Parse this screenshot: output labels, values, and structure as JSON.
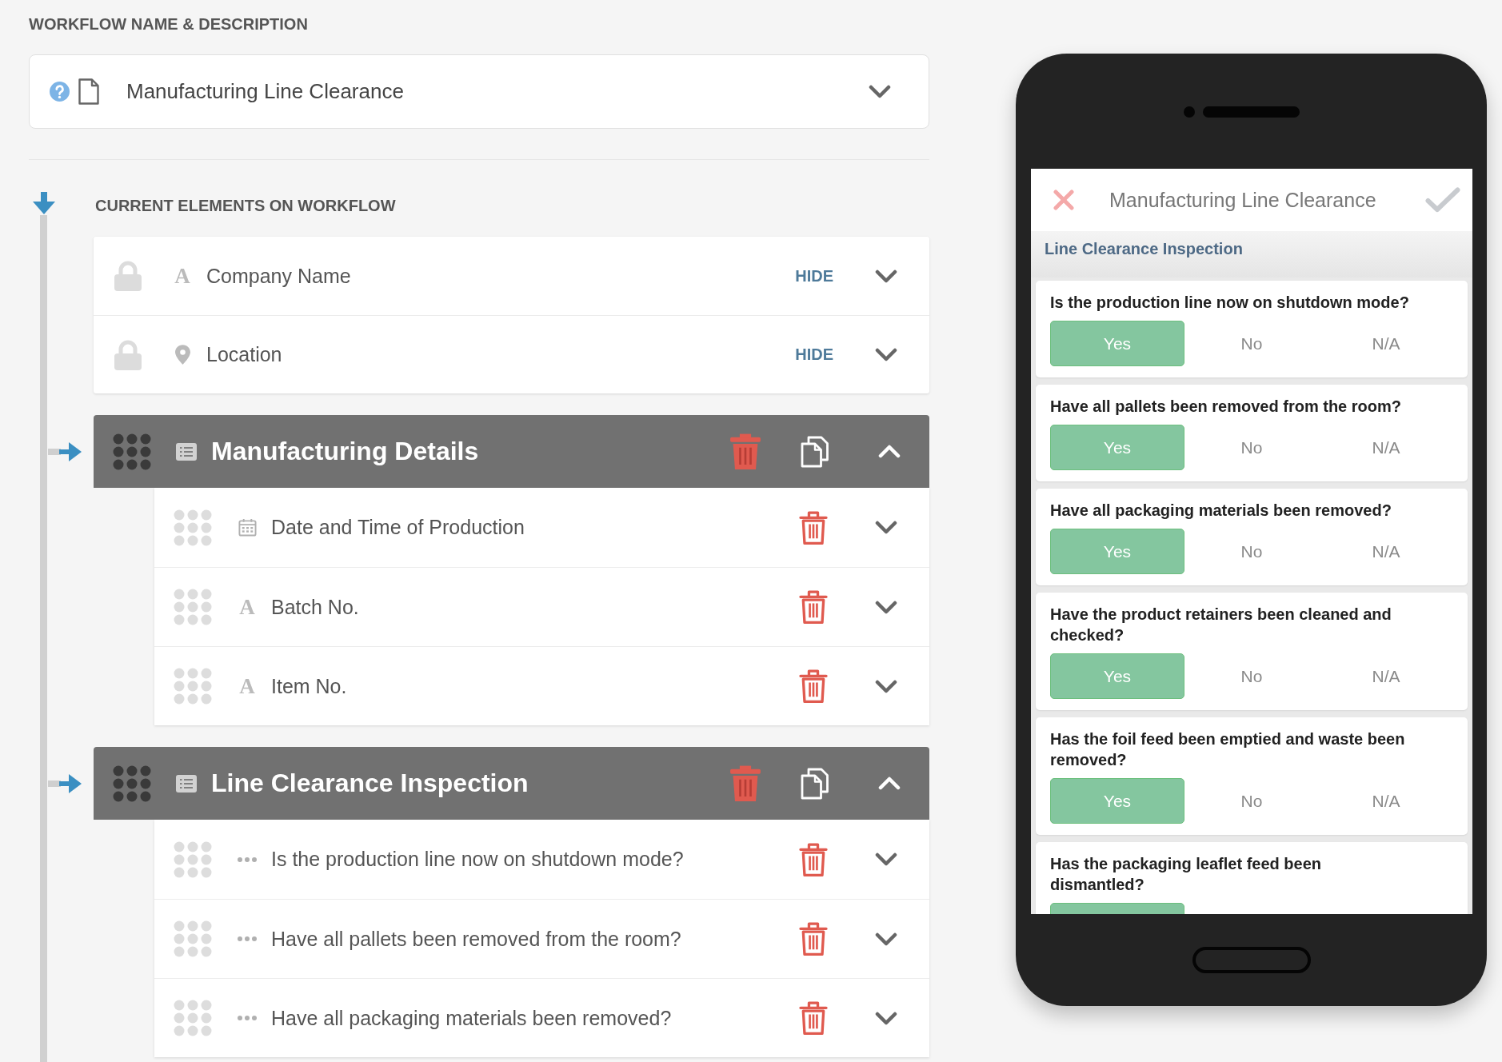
{
  "workflow": {
    "heading": "WORKFLOW NAME & DESCRIPTION",
    "name": "Manufacturing Line Clearance",
    "expanded": false
  },
  "elements": {
    "heading": "CURRENT ELEMENTS ON WORKFLOW",
    "locked_fields": [
      {
        "label": "Company Name",
        "kind": "text",
        "glyph": "A",
        "locked": true,
        "action": "HIDE",
        "expanded": false
      },
      {
        "label": "Location",
        "kind": "location",
        "locked": true,
        "action": "HIDE",
        "expanded": false
      }
    ],
    "sections": [
      {
        "title": "Manufacturing Details",
        "expanded": true,
        "fields": [
          {
            "label": "Date and Time of Production",
            "kind": "date",
            "expanded": false
          },
          {
            "label": "Batch No.",
            "kind": "text",
            "glyph": "A",
            "expanded": false
          },
          {
            "label": "Item No.",
            "kind": "text",
            "glyph": "A",
            "expanded": false
          }
        ]
      },
      {
        "title": "Line Clearance Inspection",
        "expanded": true,
        "fields": [
          {
            "label": "Is the production line now on shutdown mode?",
            "kind": "choice",
            "expanded": false
          },
          {
            "label": "Have all pallets been removed from the room?",
            "kind": "choice",
            "expanded": false
          },
          {
            "label": "Have all packaging materials been removed?",
            "kind": "choice",
            "expanded": false
          }
        ]
      }
    ]
  },
  "preview": {
    "title": "Manufacturing Line Clearance",
    "section": "Line Clearance Inspection",
    "questions": [
      {
        "text": "Is the production line now on shutdown mode?",
        "options": [
          {
            "label": "Yes",
            "selected": true
          },
          {
            "label": "No",
            "selected": false
          },
          {
            "label": "N/A",
            "selected": false
          }
        ]
      },
      {
        "text": "Have all pallets been removed from the room?",
        "options": [
          {
            "label": "Yes",
            "selected": true
          },
          {
            "label": "No",
            "selected": false
          },
          {
            "label": "N/A",
            "selected": false
          }
        ]
      },
      {
        "text": "Have all packaging materials been removed?",
        "options": [
          {
            "label": "Yes",
            "selected": true
          },
          {
            "label": "No",
            "selected": false
          },
          {
            "label": "N/A",
            "selected": false
          }
        ]
      },
      {
        "text": "Have the product retainers been cleaned and checked?",
        "options": [
          {
            "label": "Yes",
            "selected": true
          },
          {
            "label": "No",
            "selected": false
          },
          {
            "label": "N/A",
            "selected": false
          }
        ]
      },
      {
        "text": "Has the foil feed been emptied and waste been removed?",
        "options": [
          {
            "label": "Yes",
            "selected": true
          },
          {
            "label": "No",
            "selected": false
          },
          {
            "label": "N/A",
            "selected": false
          }
        ]
      },
      {
        "text": "Has the packaging leaflet feed been dismantled?",
        "options": [
          {
            "selected": true
          }
        ]
      }
    ]
  }
}
